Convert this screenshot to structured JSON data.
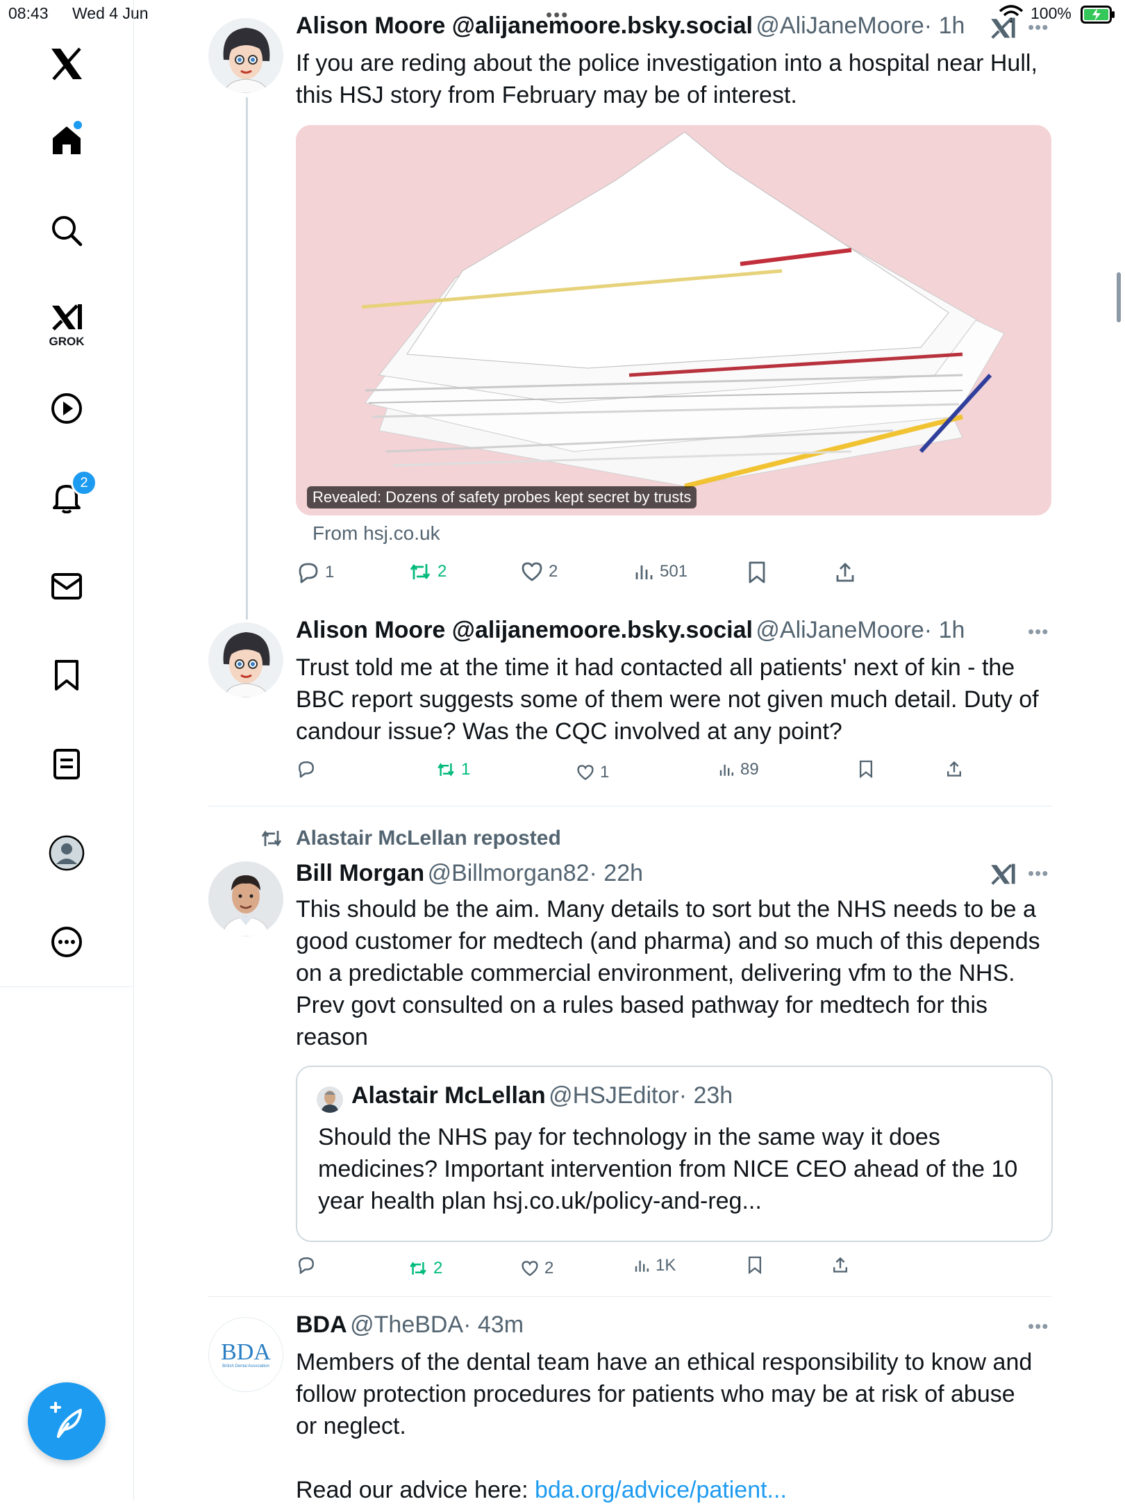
{
  "status_bar": {
    "time": "08:43",
    "date": "Wed 4 Jun",
    "battery": "100%"
  },
  "sidebar": {
    "notifications_badge": "2",
    "grok_label": "GROK"
  },
  "tweets": [
    {
      "name": "Alison Moore @alijanemoore.bsky.social",
      "handle": "@AliJaneMoore",
      "time": "· 1h",
      "text": "If you are reding about the police investigation into a hospital near Hull,\nthis HSJ story from February may be of interest.",
      "card_caption": "Revealed: Dozens of safety probes kept secret by trusts",
      "card_source": "From hsj.co.uk",
      "replies": "1",
      "reposts": "2",
      "likes": "2",
      "views": "501"
    },
    {
      "name": "Alison Moore @alijanemoore.bsky.social",
      "handle": "@AliJaneMoore",
      "time": "· 1h",
      "text": "Trust told me at the time it had contacted all patients' next of kin - the\nBBC report suggests some of them were not given much detail. Duty of\ncandour issue? Was the CQC involved at any point?",
      "replies": "",
      "reposts": "1",
      "likes": "1",
      "views": "89"
    },
    {
      "repost_label": "Alastair McLellan reposted",
      "name": "Bill Morgan",
      "handle": "@Billmorgan82",
      "time": "· 22h",
      "text": "This should be the aim. Many details to sort but the NHS needs to be a\ngood customer for medtech (and pharma) and so much of this depends\non a predictable commercial environment, delivering vfm to the NHS.\nPrev govt consulted on a rules based pathway for medtech for this\nreason",
      "quote": {
        "name": "Alastair McLellan",
        "handle": "@HSJEditor",
        "time": "· 23h",
        "text": "Should the NHS pay for technology in the same way it does\nmedicines? Important intervention from NICE CEO ahead of the 10\nyear health plan hsj.co.uk/policy-and-reg..."
      },
      "replies": "",
      "reposts": "2",
      "likes": "2",
      "views": "1K"
    },
    {
      "name": "BDA",
      "handle": "@TheBDA",
      "time": "· 43m",
      "avatar_text": "BDA",
      "avatar_subtext": "British Dental Association",
      "text": "Members of the dental team have an ethical responsibility to know and\nfollow protection procedures for patients who may be at risk of abuse\nor neglect.",
      "link_prefix": "Read our advice here: ",
      "link": "bda.org/advice/patient..."
    }
  ],
  "colors": {
    "accent": "#1d9bf0",
    "repost_green": "#00ba7c",
    "secondary_text": "#536471",
    "card_bg": "#f3d3d6"
  }
}
